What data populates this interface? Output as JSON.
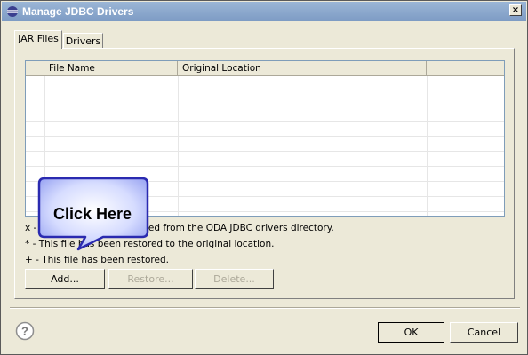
{
  "window": {
    "title": "Manage JDBC Drivers",
    "close_glyph": "×"
  },
  "tabs": [
    {
      "label": "JAR Files",
      "active": true
    },
    {
      "label": "Drivers",
      "active": false
    }
  ],
  "table": {
    "columns": [
      "",
      "File Name",
      "Original Location",
      ""
    ],
    "rows": []
  },
  "legend": {
    "x_line": "x - This file has been deleted from the ODA JDBC drivers directory.",
    "star_line": "* - This file has been restored to the original location.",
    "plus_line": "+ - This file has been restored."
  },
  "buttons": {
    "add": "Add...",
    "restore": "Restore...",
    "delete": "Delete...",
    "ok": "OK",
    "cancel": "Cancel"
  },
  "callout": {
    "text": "Click Here"
  },
  "colors": {
    "titlebar": "#7d9bc4",
    "callout_fill": "#bfc8ff",
    "callout_border": "#2a2ab0",
    "dialog_bg": "#ece9d8"
  }
}
